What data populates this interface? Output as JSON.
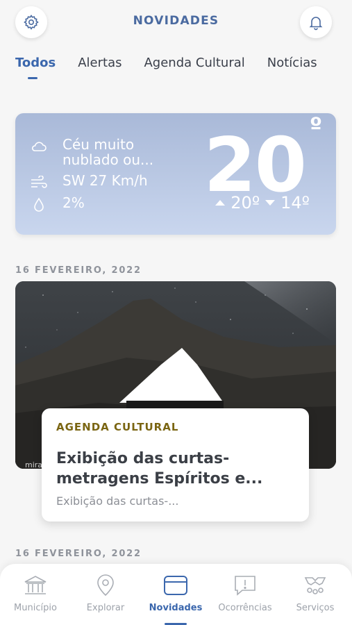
{
  "header": {
    "title": "NOVIDADES",
    "settings_icon": "gear-icon",
    "notifications_icon": "bell-icon"
  },
  "tabs": [
    {
      "label": "Todos",
      "active": true
    },
    {
      "label": "Alertas",
      "active": false
    },
    {
      "label": "Agenda Cultural",
      "active": false
    },
    {
      "label": "Notícias",
      "active": false
    }
  ],
  "weather": {
    "condition": "Céu muito nublado ou...",
    "wind": "SW 27 Km/h",
    "precipitation": "2%",
    "temperature": "20",
    "degree_symbol": "º",
    "max": "20º",
    "min": "14º"
  },
  "feed": [
    {
      "date": "16 FEVEREIRO, 2022",
      "category": "AGENDA CULTURAL",
      "title": "Exibição das curtas-metragens Espíritos e...",
      "subtitle": "Exibição das curtas-...",
      "image_caption": "mira"
    },
    {
      "date": "16 FEVEREIRO, 2022"
    }
  ],
  "bottom_nav": [
    {
      "label": "Município",
      "icon": "building-icon",
      "active": false
    },
    {
      "label": "Explorar",
      "icon": "map-pin-icon",
      "active": false
    },
    {
      "label": "Novidades",
      "icon": "news-card-icon",
      "active": true
    },
    {
      "label": "Ocorrências",
      "icon": "alert-chat-icon",
      "active": false
    },
    {
      "label": "Serviços",
      "icon": "services-icon",
      "active": false
    }
  ],
  "colors": {
    "accent": "#3b67ad",
    "category": "#7a6512",
    "weather_bg": "#b4c4e2"
  }
}
